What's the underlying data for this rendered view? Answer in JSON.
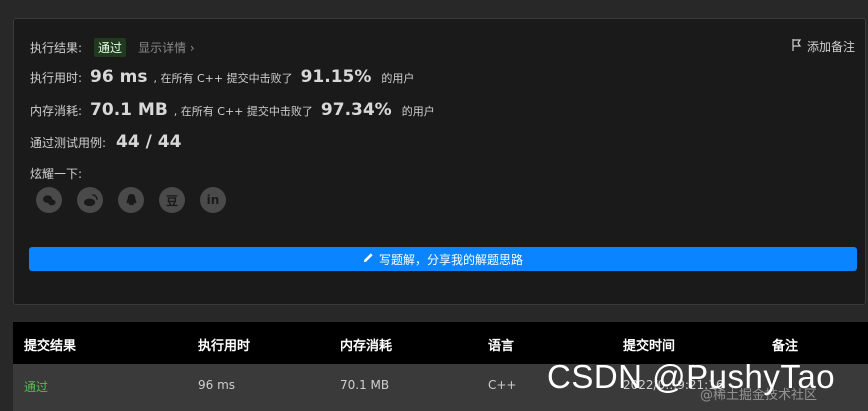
{
  "result": {
    "label": "执行结果:",
    "status": "通过",
    "details_link": "显示详情 ›",
    "add_note": "添加备注"
  },
  "runtime": {
    "label": "执行用时:",
    "value": "96 ms",
    "middle": ", 在所有 C++ 提交中击败了",
    "percent": "91.15%",
    "suffix": "的用户"
  },
  "memory": {
    "label": "内存消耗:",
    "value": "70.1 MB",
    "middle": ", 在所有 C++ 提交中击败了",
    "percent": "97.34%",
    "suffix": "的用户"
  },
  "tests": {
    "label": "通过测试用例:",
    "value": "44 / 44"
  },
  "share": {
    "label": "炫耀一下:",
    "douban": "豆",
    "linkedin": "in"
  },
  "write_button": "写题解，分享我的解题思路",
  "table": {
    "headers": [
      "提交结果",
      "执行用时",
      "内存消耗",
      "语言",
      "提交时间",
      "备注"
    ],
    "row": [
      "通过",
      "96 ms",
      "70.1 MB",
      "C++",
      "2022/0…9:21:16",
      ""
    ]
  },
  "watermark": "CSDN @PushyTao",
  "watermark_sub": "@稀土掘金技术社区",
  "colors": {
    "accent": "#0a84ff",
    "success": "#5cb85c"
  }
}
